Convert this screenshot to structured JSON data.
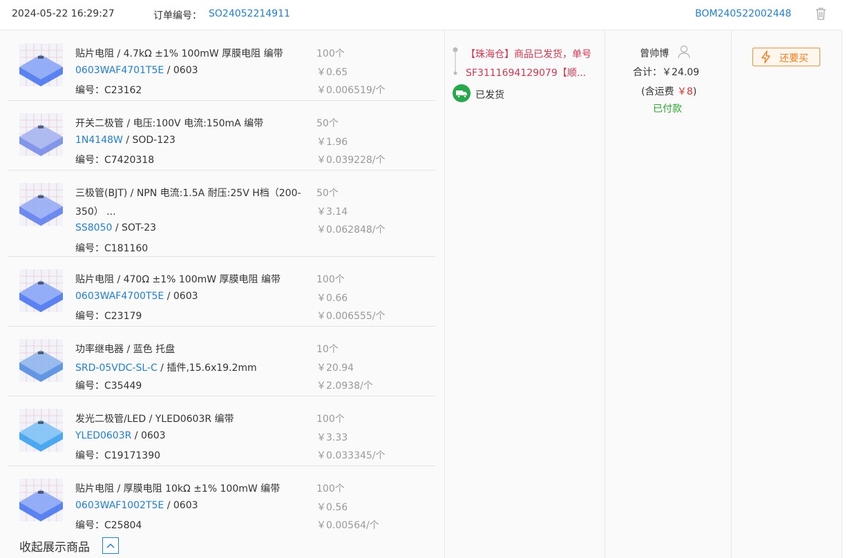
{
  "header": {
    "datetime": "2024-05-22 16:29:27",
    "order_label": "订单编号：",
    "order_no": "SO24052214911",
    "bom_no": "BOM240522002448"
  },
  "items": [
    {
      "title": "贴片电阻 / 4.7kΩ ±1% 100mW 厚膜电阻 编带",
      "title2": "",
      "part": "0603WAF4701T5E",
      "pkg": " / 0603",
      "code": "编号：C23162",
      "qty": "100个",
      "price": "￥0.65",
      "unit": "￥0.006519/个",
      "color": "#3f6ff0"
    },
    {
      "title": "开关二极管 / 电压:100V 电流:150mA 编带",
      "title2": "",
      "part": "1N4148W",
      "pkg": " / SOD-123",
      "code": "编号：C7420318",
      "qty": "50个",
      "price": "￥1.96",
      "unit": "￥0.039228/个",
      "color": "#6f86e8"
    },
    {
      "title": "三极管(BJT) / NPN 电流:1.5A 耐压:25V H档（200-",
      "title2": "350） ...",
      "part": "SS8050",
      "pkg": " / SOT-23",
      "code": "编号：C181160",
      "qty": "50个",
      "price": "￥3.14",
      "unit": "￥0.062848/个",
      "color": "#5577ee"
    },
    {
      "title": "贴片电阻 / 470Ω ±1% 100mW 厚膜电阻 编带",
      "title2": "",
      "part": "0603WAF4700T5E",
      "pkg": " / 0603",
      "code": "编号：C23179",
      "qty": "100个",
      "price": "￥0.66",
      "unit": "￥0.006555/个",
      "color": "#3f6ff0"
    },
    {
      "title": "功率继电器 / 蓝色 托盘",
      "title2": "",
      "part": "SRD-05VDC-SL-C",
      "pkg": " / 插件,15.6x19.2mm",
      "code": "编号：C35449",
      "qty": "10个",
      "price": "￥20.94",
      "unit": "￥2.0938/个",
      "color": "#4a86e0"
    },
    {
      "title": "发光二极管/LED / YLED0603R 编带",
      "title2": "",
      "part": "YLED0603R",
      "pkg": " / 0603",
      "code": "编号：C19171390",
      "qty": "100个",
      "price": "￥3.33",
      "unit": "￥0.033345/个",
      "color": "#2f9bf0"
    },
    {
      "title": "贴片电阻 / 厚膜电阻 10kΩ ±1% 100mW 编带",
      "title2": "",
      "part": "0603WAF1002T5E",
      "pkg": " / 0603",
      "code": "编号：C25804",
      "qty": "100个",
      "price": "￥0.56",
      "unit": "￥0.00564/个",
      "color": "#3f6ff0"
    }
  ],
  "shipment": {
    "message": "【珠海仓】商品已发货，单号SF3111694129079【顺...",
    "status": "已发货"
  },
  "buyer": {
    "name": "曾帅博",
    "total": "合计：￥24.09",
    "ship_prefix": "(含运费 ",
    "ship_fee": "￥8",
    "ship_suffix": ")",
    "paid": "已付款"
  },
  "actions": {
    "rebuy": "还要买",
    "collapse": "收起展示商品"
  }
}
